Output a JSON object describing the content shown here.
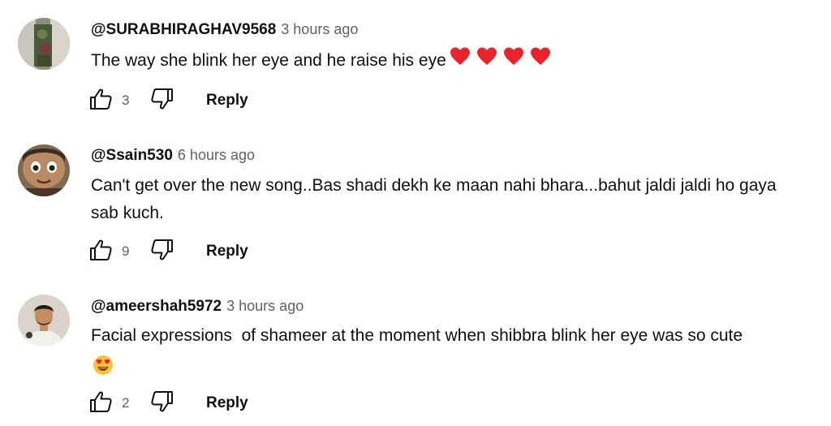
{
  "comments": [
    {
      "author": "@SURABHIRAGHAV9568",
      "time": "3 hours ago",
      "text": "The way she blink her eye and he raise his eye",
      "emoji": "heart-icon x4",
      "likes": "3",
      "reply_label": "Reply"
    },
    {
      "author": "@Ssain530",
      "time": "6 hours ago",
      "text": "Can't get over the new song..Bas shadi dekh ke maan nahi bhara...bahut jaldi jaldi ho gaya sab kuch.",
      "likes": "9",
      "reply_label": "Reply"
    },
    {
      "author": "@ameershah5972",
      "time": "3 hours ago",
      "text": "Facial expressions  of shameer at the moment when shibbra blink her eye was so cute",
      "emoji": "heart-eyes-emoji",
      "likes": "2",
      "reply_label": "Reply"
    }
  ],
  "colors": {
    "text": "#0f0f0f",
    "secondary": "#606060",
    "heart": "#e8232c",
    "emoji_face": "#f7c23e"
  }
}
